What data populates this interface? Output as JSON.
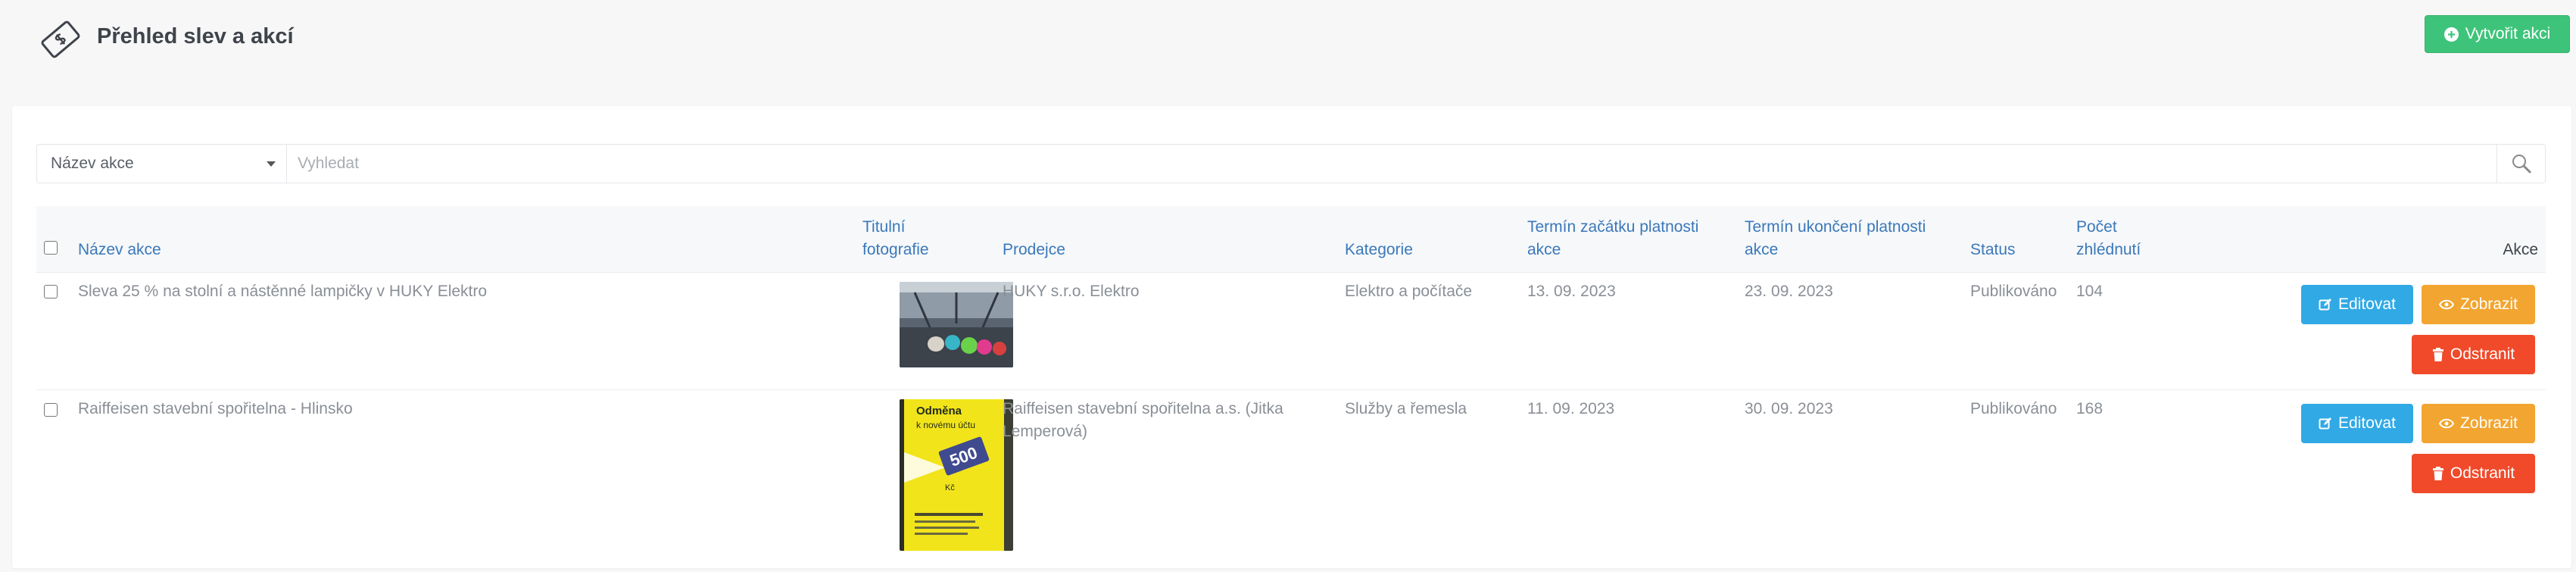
{
  "header": {
    "title": "Přehled slev a akcí",
    "create_label": "Vytvořit akci"
  },
  "filter": {
    "selected": "Název akce",
    "search_placeholder": "Vyhledat"
  },
  "table": {
    "columns": {
      "name": "Název akce",
      "photo_1": "Titulní",
      "photo_2": "fotografie",
      "seller": "Prodejce",
      "category": "Kategorie",
      "start_1": "Termín začátku platnosti",
      "start_2": "akce",
      "end_1": "Termín ukončení platnosti",
      "end_2": "akce",
      "status": "Status",
      "views_1": "Počet",
      "views_2": "zhlédnutí",
      "actions": "Akce"
    },
    "rows": [
      {
        "name": "Sleva 25 % na stolní a nástěnné lampičky v HUKY Elektro",
        "seller_1": "HUKY s.r.o. Elektro",
        "seller_2": "",
        "category": "Elektro a počítače",
        "start": "13. 09. 2023",
        "end": "23. 09. 2023",
        "status": "Publikováno",
        "views": "104"
      },
      {
        "name": "Raiffeisen stavební spořitelna - Hlinsko",
        "seller_1": "Raiffeisen stavební spořitelna a.s. (Jitka",
        "seller_2": "Lemperová)",
        "category": "Služby a řemesla",
        "start": "11. 09. 2023",
        "end": "30. 09. 2023",
        "status": "Publikováno",
        "views": "168"
      }
    ],
    "actions": {
      "edit": "Editovat",
      "view": "Zobrazit",
      "delete": "Odstranit"
    },
    "poster": {
      "line1": "Odměna",
      "line2": "k novému účtu",
      "amount": "500",
      "line3": "Kč"
    }
  },
  "colors": {
    "create": "#3ec47a",
    "edit": "#31a9e5",
    "view": "#f2a530",
    "delete": "#f04a2a",
    "header_link": "#3b78b9"
  }
}
